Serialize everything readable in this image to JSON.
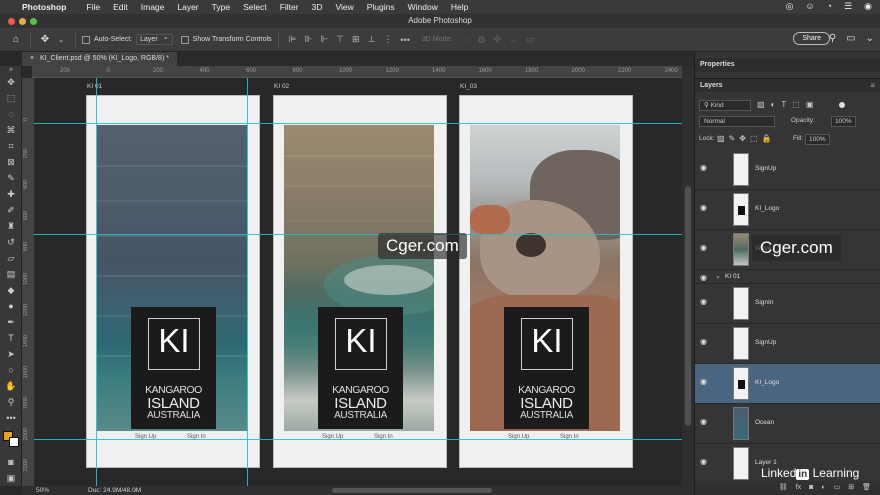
{
  "menubar": {
    "app_name": "Photoshop",
    "items": [
      "File",
      "Edit",
      "Image",
      "Layer",
      "Type",
      "Select",
      "Filter",
      "3D",
      "View",
      "Plugins",
      "Window",
      "Help"
    ],
    "window_title": "Adobe Photoshop"
  },
  "options": {
    "auto_select_label": "Auto-Select:",
    "auto_select_value": "Layer",
    "show_transform_label": "Show Transform Controls",
    "mode_3d_label": "3D Mode:",
    "share_label": "Share"
  },
  "document": {
    "tab_title": "KI_Client.psd @ 50% (KI_Logo, RGB/8) *",
    "zoom": "50%",
    "doc_size": "Doc: 24.9M/48.0M"
  },
  "rulers": {
    "top_ticks": [
      "200",
      "0",
      "200",
      "400",
      "600",
      "800",
      "1000",
      "1200",
      "1400",
      "1600",
      "1800",
      "2000",
      "2200",
      "2400"
    ],
    "left_ticks": [
      "0",
      "200",
      "400",
      "600",
      "800",
      "1000",
      "1200",
      "1400",
      "1600",
      "1800",
      "2000",
      "2200",
      "2400"
    ]
  },
  "artboards": [
    {
      "label": "KI 01",
      "photo": "ocean",
      "logo_ki": "KI",
      "logo_line1": "KANGAROO",
      "logo_line2": "ISLAND",
      "logo_line3": "AUSTRALIA",
      "signup": "Sign Up",
      "signin": "Sign In"
    },
    {
      "label": "KI 02",
      "photo": "wave",
      "logo_ki": "KI",
      "logo_line1": "KANGAROO",
      "logo_line2": "ISLAND",
      "logo_line3": "AUSTRALIA",
      "signup": "Sign Up",
      "signin": "Sign In"
    },
    {
      "label": "KI_03",
      "photo": "rock",
      "logo_ki": "KI",
      "logo_line1": "KANGAROO",
      "logo_line2": "ISLAND",
      "logo_line3": "AUSTRALIA",
      "signup": "Sign Up",
      "signin": "Sign In"
    }
  ],
  "watermark": "Cger.com",
  "panels": {
    "properties_tab": "Properties",
    "layers_tab": "Layers",
    "filter_kind": "Kind",
    "blend_mode": "Normal",
    "opacity_label": "Opacity:",
    "opacity_value": "100%",
    "lock_label": "Lock:",
    "fill_label": "Fill:",
    "fill_value": "100%",
    "layers": [
      {
        "name": "SignUp",
        "type": "artwork"
      },
      {
        "name": "KI_Logo",
        "type": "logo"
      },
      {
        "name": "Wave",
        "type": "wave"
      },
      {
        "name": "KI 01",
        "type": "group"
      },
      {
        "name": "SignIn",
        "type": "artwork"
      },
      {
        "name": "SignUp",
        "type": "artwork"
      },
      {
        "name": "KI_Logo",
        "type": "logo",
        "selected": true
      },
      {
        "name": "Ocean",
        "type": "ocean"
      },
      {
        "name": "Layer 1",
        "type": "artwork"
      }
    ],
    "footer_icons": [
      "link-icon",
      "fx-icon",
      "mask-icon",
      "adjustment-icon",
      "folder-icon",
      "new-layer-icon",
      "trash-icon"
    ]
  },
  "branding": {
    "linkedin_prefix": "Linked",
    "linkedin_in": "in",
    "linkedin_suffix": "Learning"
  },
  "colors": {
    "guide": "#1fc2c7",
    "foreground": "#e8a318",
    "background": "#ffffff",
    "selection": "#4a6580"
  }
}
